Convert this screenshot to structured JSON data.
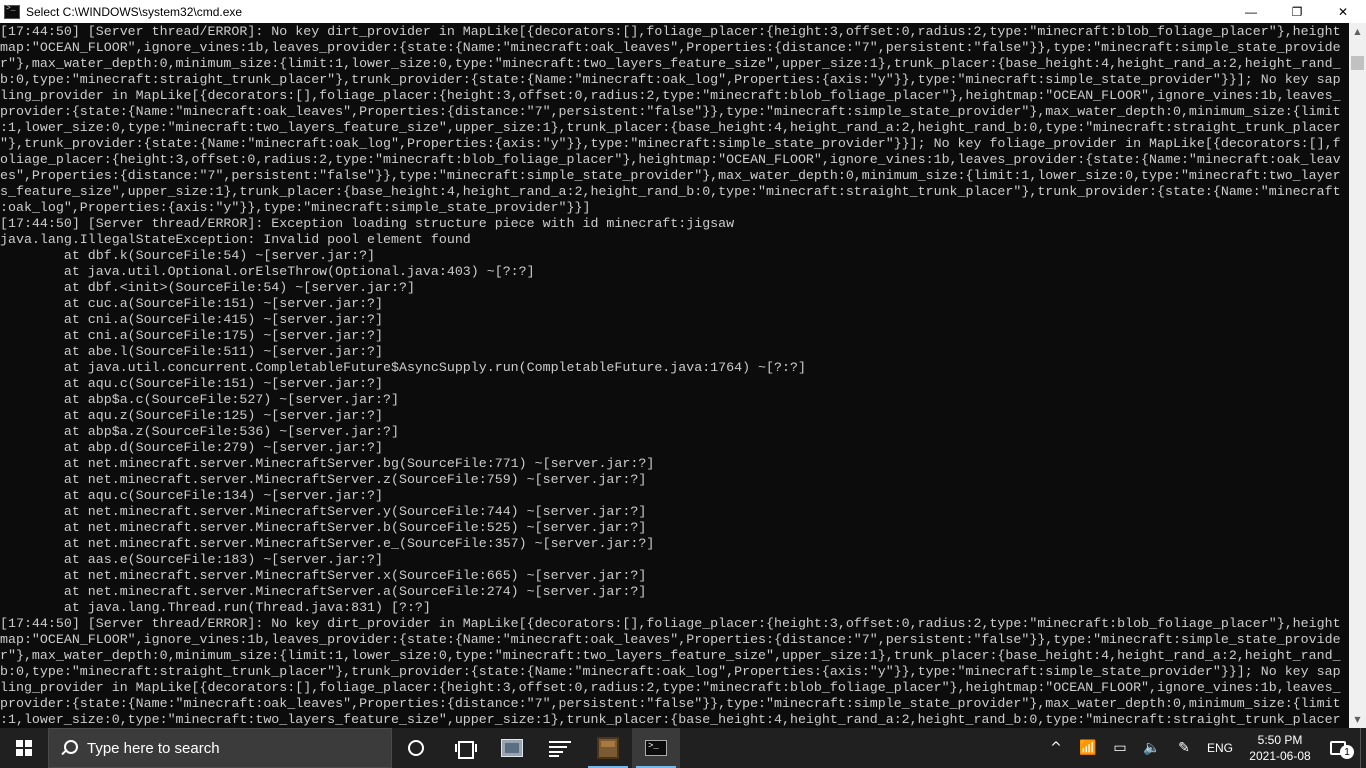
{
  "window": {
    "title": "Select C:\\WINDOWS\\system32\\cmd.exe",
    "minimize_glyph": "—",
    "maximize_glyph": "❐",
    "close_glyph": "✕"
  },
  "console": {
    "lines": [
      "[17:44:50] [Server thread/ERROR]: No key dirt_provider in MapLike[{decorators:[],foliage_placer:{height:3,offset:0,radius:2,type:\"minecraft:blob_foliage_placer\"},height",
      "map:\"OCEAN_FLOOR\",ignore_vines:1b,leaves_provider:{state:{Name:\"minecraft:oak_leaves\",Properties:{distance:\"7\",persistent:\"false\"}},type:\"minecraft:simple_state_provide",
      "r\"},max_water_depth:0,minimum_size:{limit:1,lower_size:0,type:\"minecraft:two_layers_feature_size\",upper_size:1},trunk_placer:{base_height:4,height_rand_a:2,height_rand_",
      "b:0,type:\"minecraft:straight_trunk_placer\"},trunk_provider:{state:{Name:\"minecraft:oak_log\",Properties:{axis:\"y\"}},type:\"minecraft:simple_state_provider\"}}]; No key sap",
      "ling_provider in MapLike[{decorators:[],foliage_placer:{height:3,offset:0,radius:2,type:\"minecraft:blob_foliage_placer\"},heightmap:\"OCEAN_FLOOR\",ignore_vines:1b,leaves_",
      "provider:{state:{Name:\"minecraft:oak_leaves\",Properties:{distance:\"7\",persistent:\"false\"}},type:\"minecraft:simple_state_provider\"},max_water_depth:0,minimum_size:{limit",
      ":1,lower_size:0,type:\"minecraft:two_layers_feature_size\",upper_size:1},trunk_placer:{base_height:4,height_rand_a:2,height_rand_b:0,type:\"minecraft:straight_trunk_placer",
      "\"},trunk_provider:{state:{Name:\"minecraft:oak_log\",Properties:{axis:\"y\"}},type:\"minecraft:simple_state_provider\"}}]; No key foliage_provider in MapLike[{decorators:[],f",
      "oliage_placer:{height:3,offset:0,radius:2,type:\"minecraft:blob_foliage_placer\"},heightmap:\"OCEAN_FLOOR\",ignore_vines:1b,leaves_provider:{state:{Name:\"minecraft:oak_leav",
      "es\",Properties:{distance:\"7\",persistent:\"false\"}},type:\"minecraft:simple_state_provider\"},max_water_depth:0,minimum_size:{limit:1,lower_size:0,type:\"minecraft:two_layer",
      "s_feature_size\",upper_size:1},trunk_placer:{base_height:4,height_rand_a:2,height_rand_b:0,type:\"minecraft:straight_trunk_placer\"},trunk_provider:{state:{Name:\"minecraft",
      ":oak_log\",Properties:{axis:\"y\"}},type:\"minecraft:simple_state_provider\"}}]",
      "[17:44:50] [Server thread/ERROR]: Exception loading structure piece with id minecraft:jigsaw",
      "java.lang.IllegalStateException: Invalid pool element found",
      "        at dbf.k(SourceFile:54) ~[server.jar:?]",
      "        at java.util.Optional.orElseThrow(Optional.java:403) ~[?:?]",
      "        at dbf.<init>(SourceFile:54) ~[server.jar:?]",
      "        at cuc.a(SourceFile:151) ~[server.jar:?]",
      "        at cni.a(SourceFile:415) ~[server.jar:?]",
      "        at cni.a(SourceFile:175) ~[server.jar:?]",
      "        at abe.l(SourceFile:511) ~[server.jar:?]",
      "        at java.util.concurrent.CompletableFuture$AsyncSupply.run(CompletableFuture.java:1764) ~[?:?]",
      "        at aqu.c(SourceFile:151) ~[server.jar:?]",
      "        at abp$a.c(SourceFile:527) ~[server.jar:?]",
      "        at aqu.z(SourceFile:125) ~[server.jar:?]",
      "        at abp$a.z(SourceFile:536) ~[server.jar:?]",
      "        at abp.d(SourceFile:279) ~[server.jar:?]",
      "        at net.minecraft.server.MinecraftServer.bg(SourceFile:771) ~[server.jar:?]",
      "        at net.minecraft.server.MinecraftServer.z(SourceFile:759) ~[server.jar:?]",
      "        at aqu.c(SourceFile:134) ~[server.jar:?]",
      "        at net.minecraft.server.MinecraftServer.y(SourceFile:744) ~[server.jar:?]",
      "        at net.minecraft.server.MinecraftServer.b(SourceFile:525) ~[server.jar:?]",
      "        at net.minecraft.server.MinecraftServer.e_(SourceFile:357) ~[server.jar:?]",
      "        at aas.e(SourceFile:183) ~[server.jar:?]",
      "        at net.minecraft.server.MinecraftServer.x(SourceFile:665) ~[server.jar:?]",
      "        at net.minecraft.server.MinecraftServer.a(SourceFile:274) ~[server.jar:?]",
      "        at java.lang.Thread.run(Thread.java:831) [?:?]",
      "[17:44:50] [Server thread/ERROR]: No key dirt_provider in MapLike[{decorators:[],foliage_placer:{height:3,offset:0,radius:2,type:\"minecraft:blob_foliage_placer\"},height",
      "map:\"OCEAN_FLOOR\",ignore_vines:1b,leaves_provider:{state:{Name:\"minecraft:oak_leaves\",Properties:{distance:\"7\",persistent:\"false\"}},type:\"minecraft:simple_state_provide",
      "r\"},max_water_depth:0,minimum_size:{limit:1,lower_size:0,type:\"minecraft:two_layers_feature_size\",upper_size:1},trunk_placer:{base_height:4,height_rand_a:2,height_rand_",
      "b:0,type:\"minecraft:straight_trunk_placer\"},trunk_provider:{state:{Name:\"minecraft:oak_log\",Properties:{axis:\"y\"}},type:\"minecraft:simple_state_provider\"}}]; No key sap",
      "ling_provider in MapLike[{decorators:[],foliage_placer:{height:3,offset:0,radius:2,type:\"minecraft:blob_foliage_placer\"},heightmap:\"OCEAN_FLOOR\",ignore_vines:1b,leaves_",
      "provider:{state:{Name:\"minecraft:oak_leaves\",Properties:{distance:\"7\",persistent:\"false\"}},type:\"minecraft:simple_state_provider\"},max_water_depth:0,minimum_size:{limit",
      ":1,lower_size:0,type:\"minecraft:two_layers_feature_size\",upper_size:1},trunk_placer:{base_height:4,height_rand_a:2,height_rand_b:0,type:\"minecraft:straight_trunk_placer"
    ]
  },
  "colors": {
    "console_bg": "#0c0c0c",
    "console_text": "#cccccc",
    "taskbar_bg": "#202020",
    "search_bg": "#3b3b3b",
    "running_indicator": "#76b9ed"
  },
  "taskbar": {
    "search": {
      "placeholder": "Type here to search"
    },
    "apps": [
      {
        "name": "cortana-icon"
      },
      {
        "name": "task-view-icon"
      },
      {
        "name": "file-explorer-icon"
      },
      {
        "name": "sticky-notes-icon"
      },
      {
        "name": "minecraft-icon"
      },
      {
        "name": "command-prompt-icon"
      }
    ],
    "tray": {
      "chevron": "^",
      "language": "ENG",
      "time": "5:50 PM",
      "date": "2021-06-08",
      "notification_count": "1"
    }
  }
}
